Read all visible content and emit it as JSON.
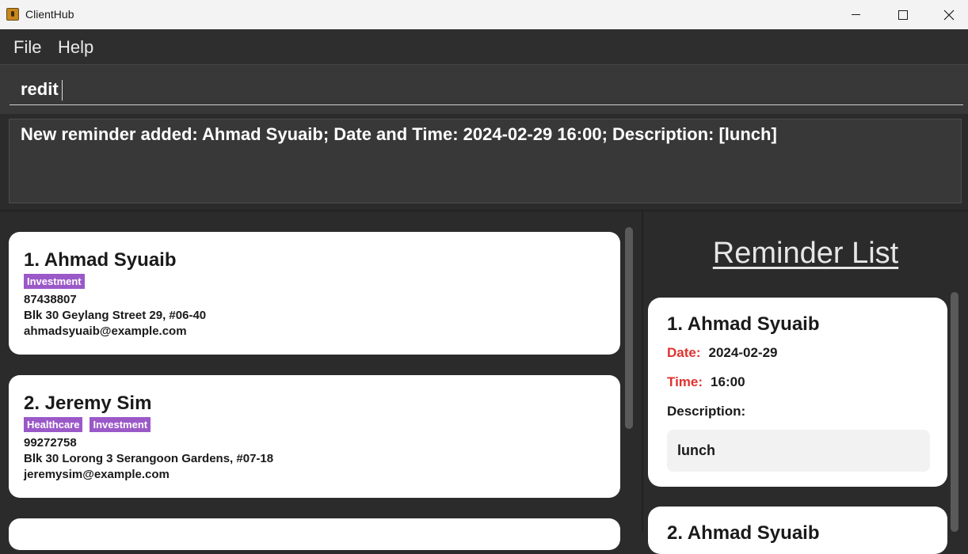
{
  "window": {
    "title": "ClientHub"
  },
  "menu": {
    "file": "File",
    "help": "Help"
  },
  "command_box": {
    "value": "redit"
  },
  "result_display": {
    "text": "New reminder added: Ahmad Syuaib; Date and Time: 2024-02-29 16:00; Description: [lunch]"
  },
  "persons": [
    {
      "name": "1. Ahmad Syuaib",
      "tags": [
        "Investment"
      ],
      "phone": "87438807",
      "address": "Blk 30 Geylang Street 29, #06-40",
      "email": "ahmadsyuaib@example.com"
    },
    {
      "name": "2. Jeremy Sim",
      "tags": [
        "Healthcare",
        "Investment"
      ],
      "phone": "99272758",
      "address": "Blk 30 Lorong 3 Serangoon Gardens, #07-18",
      "email": "jeremysim@example.com"
    }
  ],
  "reminder_panel": {
    "title": "Reminder List",
    "reminders": [
      {
        "name": "1.  Ahmad Syuaib",
        "date_label": "Date:",
        "date": "2024-02-29",
        "time_label": "Time:",
        "time": "16:00",
        "description_label": "Description:",
        "description": "lunch"
      },
      {
        "name": "2.  Ahmad Syuaib"
      }
    ]
  },
  "colors": {
    "tag": "#9b59c8",
    "label_red": "#e0332f",
    "background": "#2b2b2b"
  }
}
